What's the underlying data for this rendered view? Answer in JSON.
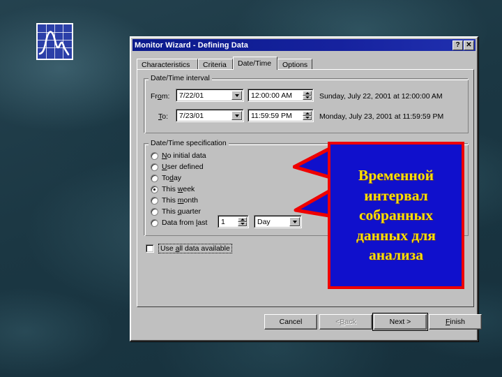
{
  "desktop": {
    "icon": {
      "name": "chart-monitor-icon"
    }
  },
  "dialog": {
    "title": "Monitor Wizard - Defining Data",
    "titlebar_buttons": [
      {
        "name": "help-button",
        "glyph": "?"
      },
      {
        "name": "close-button",
        "glyph": "✕"
      }
    ],
    "tabs": [
      {
        "label": "Characteristics",
        "active": false
      },
      {
        "label": "Criteria",
        "active": false
      },
      {
        "label": "Date/Time",
        "active": true
      },
      {
        "label": "Options",
        "active": false
      }
    ],
    "interval_group": {
      "title": "Date/Time interval",
      "rows": [
        {
          "label_pre": "Fr",
          "label_key": "o",
          "label_post": "m:",
          "date": "7/22/01",
          "time": "12:00:00 AM",
          "summary": "Sunday, July 22, 2001 at 12:00:00 AM"
        },
        {
          "label_pre": "",
          "label_key": "T",
          "label_post": "o:",
          "date": "7/23/01",
          "time": "11:59:59 PM",
          "summary": "Monday, July 23, 2001 at 11:59:59 PM"
        }
      ]
    },
    "spec_group": {
      "title": "Date/Time specification",
      "options": [
        {
          "pre": "",
          "key": "N",
          "post": "o initial data",
          "selected": false
        },
        {
          "pre": "",
          "key": "U",
          "post": "ser defined",
          "selected": false
        },
        {
          "pre": "To",
          "key": "d",
          "post": "ay",
          "selected": false
        },
        {
          "pre": "This ",
          "key": "w",
          "post": "eek",
          "selected": true
        },
        {
          "pre": "This ",
          "key": "m",
          "post": "onth",
          "selected": false
        },
        {
          "pre": "This ",
          "key": "q",
          "post": "uarter",
          "selected": false
        },
        {
          "pre": "Data from ",
          "key": "l",
          "post": "ast",
          "selected": false
        }
      ],
      "last_count": "1",
      "last_unit": "Day"
    },
    "use_all": {
      "pre": "Use ",
      "key": "a",
      "post": "ll data available",
      "checked": false
    },
    "buttons": [
      {
        "name": "cancel-button",
        "pre": "Cancel",
        "key": "",
        "post": "",
        "state": "normal"
      },
      {
        "name": "back-button",
        "pre": "< ",
        "key": "B",
        "post": "ack",
        "state": "disabled"
      },
      {
        "name": "next-button",
        "pre": "Next >",
        "key": "",
        "post": "",
        "state": "default"
      },
      {
        "name": "finish-button",
        "pre": "",
        "key": "F",
        "post": "inish",
        "state": "normal"
      }
    ]
  },
  "callout": {
    "lines": [
      "Временной",
      "интервал",
      "собранных",
      "данных для",
      "анализа"
    ],
    "box_color": "#1010cc",
    "border_color": "#ee0000",
    "text_color": "#ffe000"
  }
}
